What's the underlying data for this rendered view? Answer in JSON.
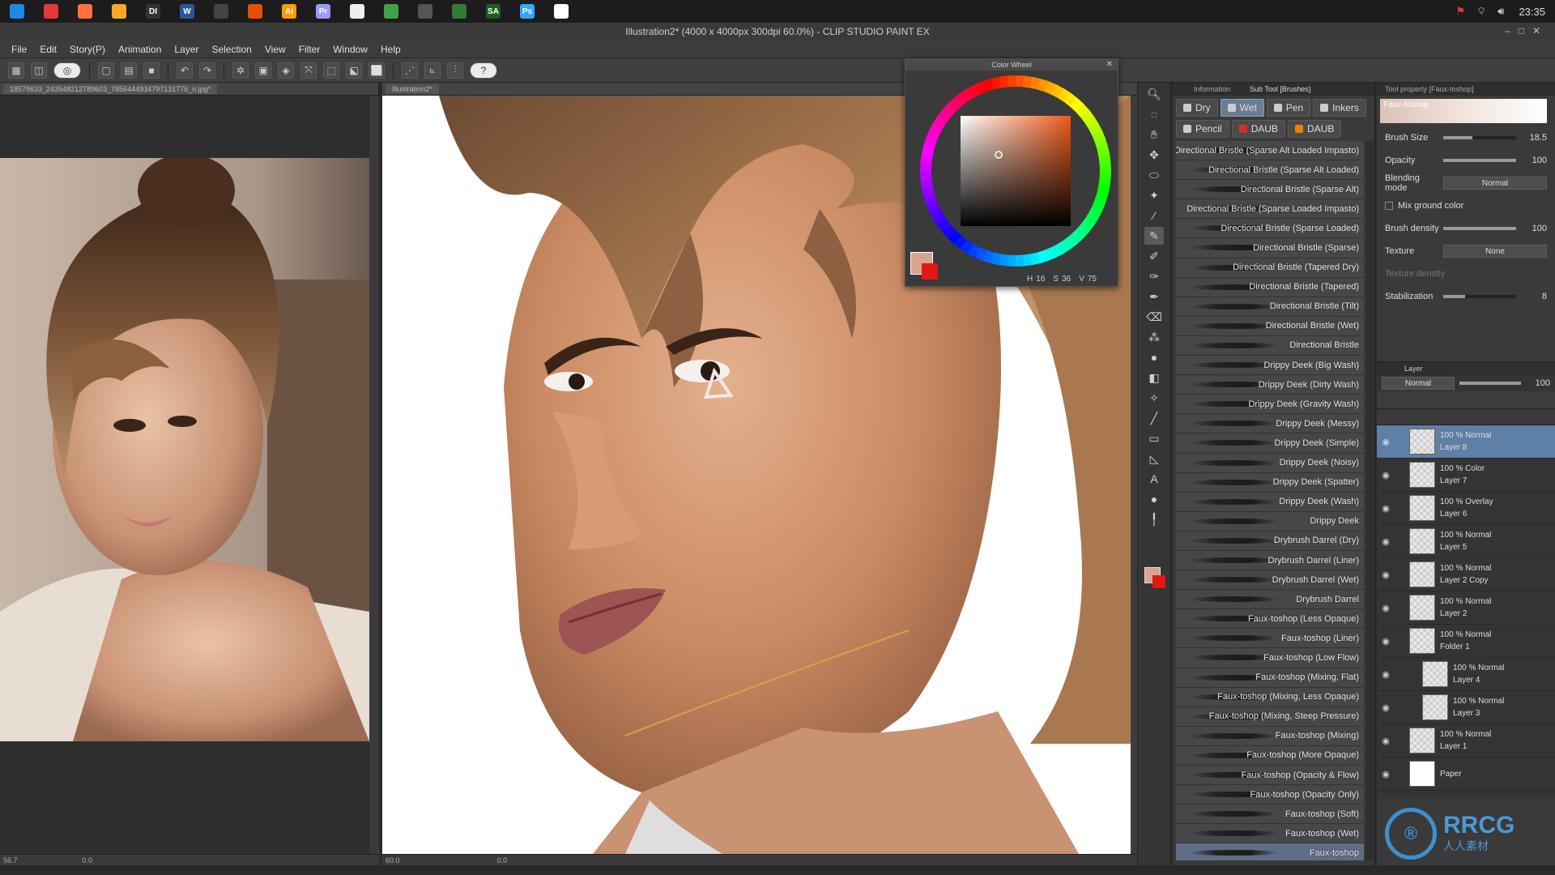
{
  "taskbar": {
    "time": "23:35",
    "apps": [
      {
        "icon": "windows-start-icon",
        "label": "",
        "color": "#1e88e5"
      },
      {
        "icon": "chrome-icon",
        "label": "",
        "color": "#e53935"
      },
      {
        "icon": "firefox-icon",
        "label": "",
        "color": "#ff7043"
      },
      {
        "icon": "folder-icon",
        "label": "",
        "color": "#f9a825"
      },
      {
        "icon": "di-app-icon",
        "label": "DI",
        "color": "#333333"
      },
      {
        "icon": "word-icon",
        "label": "W",
        "color": "#2b579a"
      },
      {
        "icon": "obs-icon",
        "label": "",
        "color": "#444444"
      },
      {
        "icon": "app-orange-icon",
        "label": "",
        "color": "#e65100"
      },
      {
        "icon": "illustrator-icon",
        "label": "Ai",
        "color": "#ff9a00"
      },
      {
        "icon": "premiere-icon",
        "label": "Pr",
        "color": "#9999ff"
      },
      {
        "icon": "clip-studio-icon",
        "label": "",
        "color": "#eeeeee"
      },
      {
        "icon": "app-green-icon",
        "label": "",
        "color": "#43a047"
      },
      {
        "icon": "maps-icon",
        "label": "",
        "color": "#555555"
      },
      {
        "icon": "app-green2-icon",
        "label": "",
        "color": "#2e7d32"
      },
      {
        "icon": "substance-icon",
        "label": "SA",
        "color": "#1b5e20"
      },
      {
        "icon": "photoshop-icon",
        "label": "Ps",
        "color": "#31a8ff"
      },
      {
        "icon": "notion-icon",
        "label": "",
        "color": "#ffffff"
      }
    ]
  },
  "window": {
    "title": "Illustration2* (4000 x 4000px 300dpi 60.0%) - CLIP STUDIO PAINT EX"
  },
  "menu": [
    "File",
    "Edit",
    "Story(P)",
    "Animation",
    "Layer",
    "Selection",
    "View",
    "Filter",
    "Window",
    "Help"
  ],
  "reference": {
    "tab": "18579633_243548212789603_7856444934797131776_n.jpg*",
    "zoom": "56.7",
    "angle": "0.0"
  },
  "canvas": {
    "tab": "Illustration2*",
    "zoom": "60.0",
    "angle": "0.0"
  },
  "color_wheel": {
    "title": "Color Wheel",
    "h": "16",
    "s": "36",
    "v": "75",
    "main_color": "#d6a58c",
    "sub_color": "#e01818"
  },
  "brush_panel": {
    "tabs": [
      "Information",
      "Sub Tool [Brushes]"
    ],
    "categories": [
      {
        "label": "Dry",
        "color": "#cccccc",
        "active": false
      },
      {
        "label": "Wet",
        "color": "#cccccc",
        "active": true
      },
      {
        "label": "Pen",
        "color": "#cccccc",
        "active": false
      },
      {
        "label": "Inkers",
        "color": "#cccccc",
        "active": false
      },
      {
        "label": "Pencil",
        "color": "#cccccc",
        "active": false
      },
      {
        "label": "DAUB",
        "color": "#d32f2f",
        "active": false
      },
      {
        "label": "DAUB",
        "color": "#f57c00",
        "active": false
      }
    ],
    "brushes": [
      "Directional Bristle (Sparse Alt Loaded Impasto)",
      "Directional Bristle (Sparse Alt Loaded)",
      "Directional Bristle (Sparse Alt)",
      "Directional Bristle (Sparse Loaded Impasto)",
      "Directional Bristle (Sparse Loaded)",
      "Directional Bristle (Sparse)",
      "Directional Bristle (Tapered Dry)",
      "Directional Bristle (Tapered)",
      "Directional Bristle (Tilt)",
      "Directional Bristle (Wet)",
      "Directional Bristle",
      "Drippy Deek (Big Wash)",
      "Drippy Deek (Dirty Wash)",
      "Drippy Deek (Gravity Wash)",
      "Drippy Deek (Messy)",
      "Drippy Deek (Simple)",
      "Drippy Deek (Noisy)",
      "Drippy Deek (Spatter)",
      "Drippy Deek (Wash)",
      "Drippy Deek",
      "Drybrush Darrel (Dry)",
      "Drybrush Darrel (Liner)",
      "Drybrush Darrel (Wet)",
      "Drybrush Darrel",
      "Faux-toshop (Less Opaque)",
      "Faux-toshop (Liner)",
      "Faux-toshop (Low Flow)",
      "Faux-toshop (Mixing, Flat)",
      "Faux-toshop (Mixing, Less Opaque)",
      "Faux-toshop (Mixing, Steep Pressure)",
      "Faux-toshop (Mixing)",
      "Faux-toshop (More Opaque)",
      "Faux-toshop (Opacity & Flow)",
      "Faux-toshop (Opacity Only)",
      "Faux-toshop (Soft)",
      "Faux-toshop (Wet)",
      "Faux-toshop"
    ],
    "active_index": 36
  },
  "tool_property": {
    "tab": "Tool property [Faux-toshop]",
    "preview_label": "Faux-toshop",
    "brush_size_label": "Brush Size",
    "brush_size": "18.5",
    "opacity_label": "Opacity",
    "opacity": "100",
    "blending_label": "Blending mode",
    "blending": "Normal",
    "mix_label": "Mix ground color",
    "density_label": "Brush density",
    "density": "100",
    "texture_label": "Texture",
    "texture": "None",
    "texture_density_label": "Texture density",
    "stabilization_label": "Stabilization",
    "stabilization": "8"
  },
  "layers": {
    "tab": "Layer",
    "blend": "Normal",
    "opacity": "100",
    "items": [
      {
        "mode": "100 % Normal",
        "name": "Layer 8",
        "selected": true,
        "child": false
      },
      {
        "mode": "100 % Color",
        "name": "Layer 7",
        "selected": false,
        "child": false
      },
      {
        "mode": "100 % Overlay",
        "name": "Layer 6",
        "selected": false,
        "child": false
      },
      {
        "mode": "100 % Normal",
        "name": "Layer 5",
        "selected": false,
        "child": false
      },
      {
        "mode": "100 % Normal",
        "name": "Layer 2 Copy",
        "selected": false,
        "child": false
      },
      {
        "mode": "100 % Normal",
        "name": "Layer 2",
        "selected": false,
        "child": false
      },
      {
        "mode": "100 % Normal",
        "name": "Folder 1",
        "selected": false,
        "child": false
      },
      {
        "mode": "100 % Normal",
        "name": "Layer 4",
        "selected": false,
        "child": true
      },
      {
        "mode": "100 % Normal",
        "name": "Layer 3",
        "selected": false,
        "child": true
      },
      {
        "mode": "100 % Normal",
        "name": "Layer 1",
        "selected": false,
        "child": false
      },
      {
        "mode": "",
        "name": "Paper",
        "selected": false,
        "child": false
      }
    ]
  },
  "watermark": {
    "logo_text": "RRCG",
    "logo_sub": "人人素材"
  }
}
